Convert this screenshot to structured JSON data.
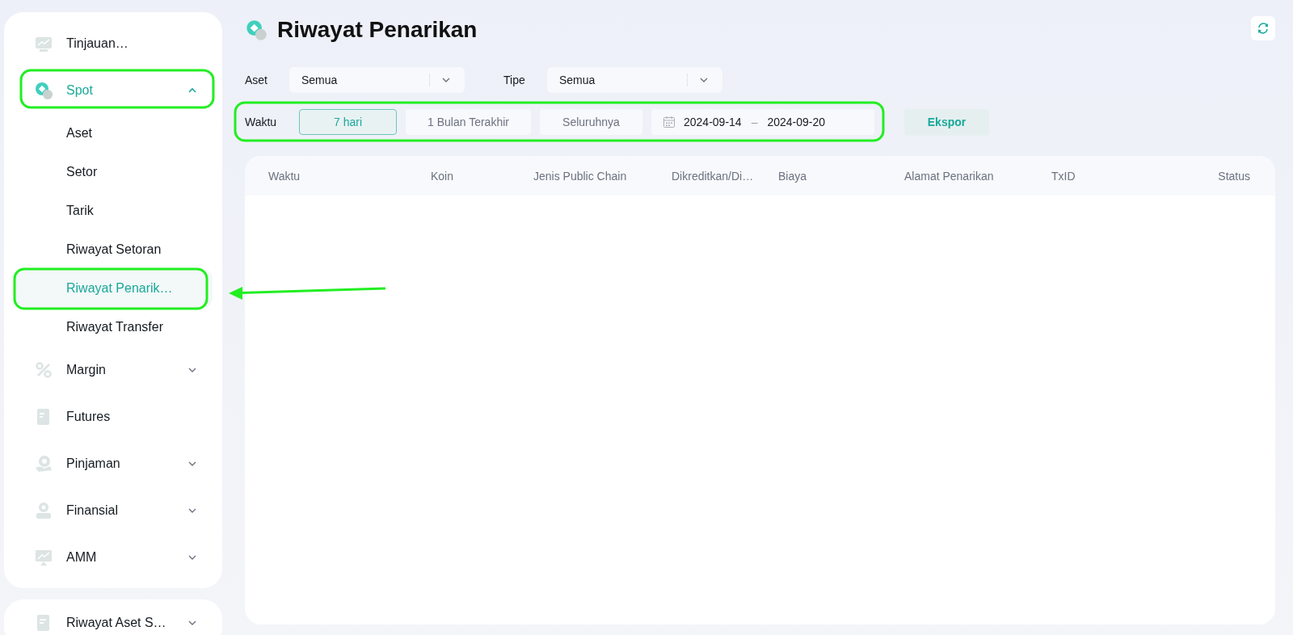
{
  "sidebar": {
    "items": [
      {
        "label": "Tinjauan…",
        "kind": "link",
        "selected": false
      },
      {
        "label": "Spot",
        "kind": "group",
        "selected": true,
        "expanded": true,
        "children": [
          {
            "label": "Aset",
            "selected": false
          },
          {
            "label": "Setor",
            "selected": false
          },
          {
            "label": "Tarik",
            "selected": false
          },
          {
            "label": "Riwayat Setoran",
            "selected": false
          },
          {
            "label": "Riwayat Penarik…",
            "selected": true
          },
          {
            "label": "Riwayat Transfer",
            "selected": false
          }
        ]
      },
      {
        "label": "Margin",
        "kind": "group",
        "selected": false,
        "expanded": false
      },
      {
        "label": "Futures",
        "kind": "link",
        "selected": false
      },
      {
        "label": "Pinjaman",
        "kind": "group",
        "selected": false,
        "expanded": false
      },
      {
        "label": "Finansial",
        "kind": "group",
        "selected": false,
        "expanded": false
      },
      {
        "label": "AMM",
        "kind": "group",
        "selected": false,
        "expanded": false
      }
    ]
  },
  "sidebar_secondary": {
    "items": [
      {
        "label": "Riwayat Aset S…",
        "kind": "group",
        "selected": false,
        "expanded": false
      }
    ]
  },
  "page": {
    "title": "Riwayat Penarikan"
  },
  "filters": {
    "selects": [
      {
        "label": "Aset",
        "value": "Semua"
      },
      {
        "label": "Tipe",
        "value": "Semua"
      }
    ],
    "time": {
      "label": "Waktu",
      "options": [
        {
          "label": "7 hari",
          "selected": true
        },
        {
          "label": "1 Bulan Terakhir",
          "selected": false
        },
        {
          "label": "Seluruhnya",
          "selected": false
        }
      ],
      "date_range": {
        "start": "2024-09-14",
        "separator": "–",
        "end": "2024-09-20"
      }
    },
    "export_button": "Ekspor"
  },
  "table": {
    "columns": [
      "Waktu",
      "Koin",
      "Jenis Public Chain",
      "Dikreditkan/Di…",
      "Biaya",
      "Alamat Penarikan",
      "TxID",
      "Status"
    ]
  }
}
